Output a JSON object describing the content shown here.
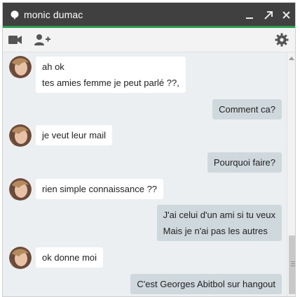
{
  "window": {
    "title": "monic dumac",
    "icons": {
      "status": "speech-bubble-icon",
      "minimize": "minimize-icon",
      "popout": "popout-icon",
      "close": "close-icon"
    },
    "accent_color": "#2e9e4e"
  },
  "toolbar": {
    "icons": {
      "video": "video-camera-icon",
      "add_person": "add-person-icon",
      "settings": "gear-icon"
    }
  },
  "messages": [
    {
      "from": "contact",
      "lines": [
        "ah ok",
        "tes amies femme je peut parlé ??,"
      ]
    },
    {
      "from": "me",
      "lines": [
        "Comment ca?"
      ]
    },
    {
      "from": "contact",
      "lines": [
        "je veut leur mail"
      ]
    },
    {
      "from": "me",
      "lines": [
        "Pourquoi faire?"
      ]
    },
    {
      "from": "contact",
      "lines": [
        "rien simple connaissance ??"
      ]
    },
    {
      "from": "me",
      "lines": [
        "J'ai celui d'un ami si tu veux",
        "Mais je n'ai pas les autres"
      ]
    },
    {
      "from": "contact",
      "lines": [
        "ok donne moi"
      ]
    },
    {
      "from": "me",
      "lines": [
        "C'est Georges Abitbol sur hangout"
      ]
    }
  ],
  "colors": {
    "incoming_bubble": "#ffffff",
    "outgoing_bubble": "#cfd8dc",
    "background": "#eceff1"
  }
}
